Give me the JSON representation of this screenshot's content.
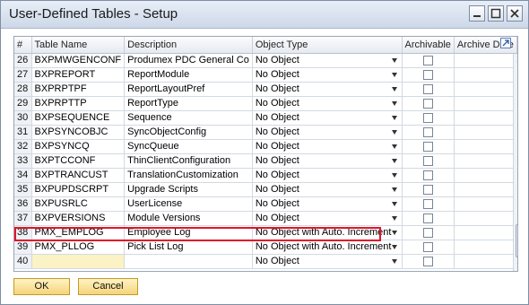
{
  "window": {
    "title": "User-Defined Tables - Setup"
  },
  "columns": [
    "#",
    "Table Name",
    "Description",
    "Object Type",
    "Archivable",
    "Archive Date"
  ],
  "rows": [
    {
      "num": "26",
      "name": "BXPMWGENCONF",
      "desc": "Produmex PDC General Co",
      "type": "No Object"
    },
    {
      "num": "27",
      "name": "BXPREPORT",
      "desc": "ReportModule",
      "type": "No Object"
    },
    {
      "num": "28",
      "name": "BXPRPTPF",
      "desc": "ReportLayoutPref",
      "type": "No Object"
    },
    {
      "num": "29",
      "name": "BXPRPTTP",
      "desc": "ReportType",
      "type": "No Object"
    },
    {
      "num": "30",
      "name": "BXPSEQUENCE",
      "desc": "Sequence",
      "type": "No Object"
    },
    {
      "num": "31",
      "name": "BXPSYNCOBJC",
      "desc": "SyncObjectConfig",
      "type": "No Object"
    },
    {
      "num": "32",
      "name": "BXPSYNCQ",
      "desc": "SyncQueue",
      "type": "No Object"
    },
    {
      "num": "33",
      "name": "BXPTCCONF",
      "desc": "ThinClientConfiguration",
      "type": "No Object"
    },
    {
      "num": "34",
      "name": "BXPTRANCUST",
      "desc": "TranslationCustomization",
      "type": "No Object"
    },
    {
      "num": "35",
      "name": "BXPUPDSCRPT",
      "desc": "Upgrade Scripts",
      "type": "No Object"
    },
    {
      "num": "36",
      "name": "BXPUSRLC",
      "desc": "UserLicense",
      "type": "No Object"
    },
    {
      "num": "37",
      "name": "BXPVERSIONS",
      "desc": "Module Versions",
      "type": "No Object"
    },
    {
      "num": "38",
      "name": "PMX_EMPLOG",
      "desc": "Employee Log",
      "type": "No Object with Auto. Increment"
    },
    {
      "num": "39",
      "name": "PMX_PLLOG",
      "desc": "Pick List Log",
      "type": "No Object with Auto. Increment"
    },
    {
      "num": "40",
      "name": "",
      "desc": "",
      "type": "No Object"
    }
  ],
  "buttons": {
    "ok": "OK",
    "cancel": "Cancel"
  },
  "colors": {
    "highlight": "#e0142c",
    "button": "#f5d47a"
  }
}
